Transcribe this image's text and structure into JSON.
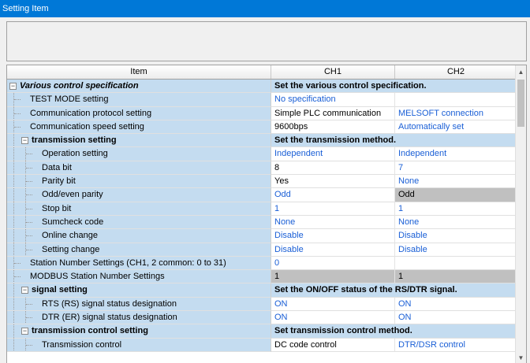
{
  "window": {
    "title": "Setting Item"
  },
  "columns": {
    "item": "Item",
    "ch1": "CH1",
    "ch2": "CH2"
  },
  "rows": [
    {
      "label": "Various control specification",
      "span": "Set the various control specification."
    },
    {
      "label": "TEST MODE setting",
      "ch1": "No specification",
      "ch2": ""
    },
    {
      "label": "Communication protocol setting",
      "ch1": "Simple PLC communication",
      "ch2": "MELSOFT connection"
    },
    {
      "label": "Communication speed setting",
      "ch1": "9600bps",
      "ch2": "Automatically set"
    },
    {
      "label": "transmission setting",
      "span": "Set the transmission method."
    },
    {
      "label": "Operation setting",
      "ch1": "Independent",
      "ch2": "Independent"
    },
    {
      "label": "Data bit",
      "ch1": "8",
      "ch2": "7"
    },
    {
      "label": "Parity bit",
      "ch1": "Yes",
      "ch2": "None"
    },
    {
      "label": "Odd/even parity",
      "ch1": "Odd",
      "ch2": "Odd"
    },
    {
      "label": "Stop bit",
      "ch1": "1",
      "ch2": "1"
    },
    {
      "label": "Sumcheck code",
      "ch1": "None",
      "ch2": "None"
    },
    {
      "label": "Online change",
      "ch1": "Disable",
      "ch2": "Disable"
    },
    {
      "label": "Setting change",
      "ch1": "Disable",
      "ch2": "Disable"
    },
    {
      "label": "Station Number Settings (CH1, 2 common: 0 to 31)",
      "ch1": "0",
      "ch2": ""
    },
    {
      "label": "MODBUS Station Number Settings",
      "ch1": "1",
      "ch2": "1"
    },
    {
      "label": "signal setting",
      "span": "Set the ON/OFF status of the RS/DTR signal."
    },
    {
      "label": "RTS (RS) signal status designation",
      "ch1": "ON",
      "ch2": "ON"
    },
    {
      "label": "DTR (ER) signal status designation",
      "ch1": "ON",
      "ch2": "ON"
    },
    {
      "label": "transmission control setting",
      "span": "Set transmission control method."
    },
    {
      "label": "Transmission control",
      "ch1": "DC code control",
      "ch2": "DTR/DSR control"
    }
  ],
  "icons": {
    "collapse": "minus-box-icon",
    "scroll_up": "chevron-up-icon",
    "scroll_down": "chevron-down-icon"
  },
  "colors": {
    "titlebar": "#0078d7",
    "item_bg": "#c4dcf0",
    "value_blue": "#1a5fd6",
    "shaded_cell": "#c0c0c0"
  }
}
